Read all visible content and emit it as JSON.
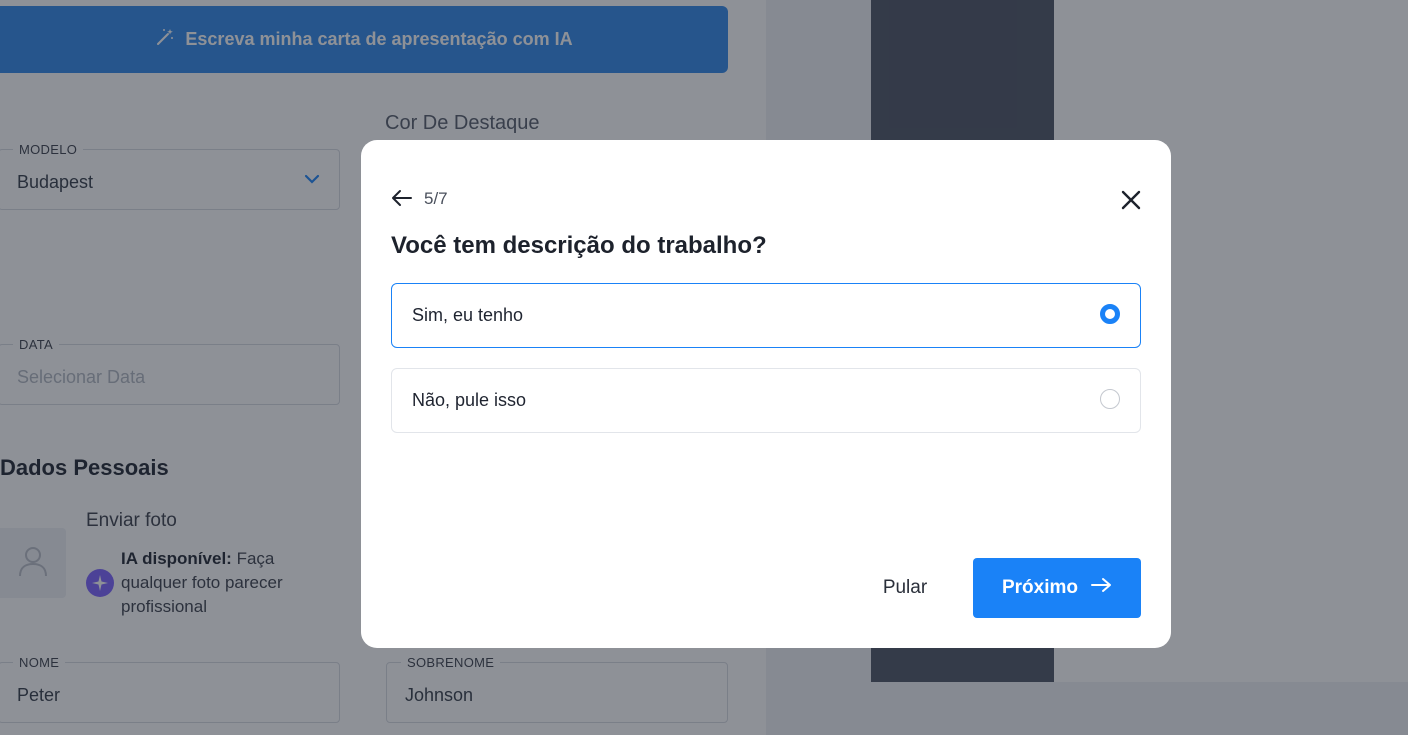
{
  "editor": {
    "ai_letter_button": "Escreva minha carta de apresentação com IA",
    "template_field": {
      "label": "MODELO",
      "value": "Budapest"
    },
    "accent_color_label": "Cor De Destaque",
    "date_field": {
      "label": "DATA",
      "placeholder": "Selecionar Data"
    },
    "personal_section_title": "Dados Pessoais",
    "photo_upload_label": "Enviar foto",
    "ai_photo": {
      "bold": "IA disponível:",
      "text": "Faça qualquer foto parecer profissional"
    },
    "first_name_field": {
      "label": "NOME",
      "value": "Peter"
    },
    "last_name_field": {
      "label": "SOBRENOME",
      "value": "Johnson"
    }
  },
  "modal": {
    "step": "5/7",
    "title": "Você tem descrição do trabalho?",
    "options": [
      {
        "label": "Sim, eu tenho",
        "selected": true
      },
      {
        "label": "Não, pule isso",
        "selected": false
      }
    ],
    "skip_label": "Pular",
    "next_label": "Próximo"
  },
  "colors": {
    "primary": "#1a82f7",
    "overlay": "rgba(30,35,48,0.5)",
    "preview_sidebar": "#4a5262",
    "ai_badge": "#7b61ff"
  },
  "icons": [
    "magic-wand-icon",
    "chevron-down-icon",
    "user-placeholder-icon",
    "ai-sparkle-icon",
    "arrow-left-icon",
    "close-icon",
    "arrow-right-icon"
  ]
}
